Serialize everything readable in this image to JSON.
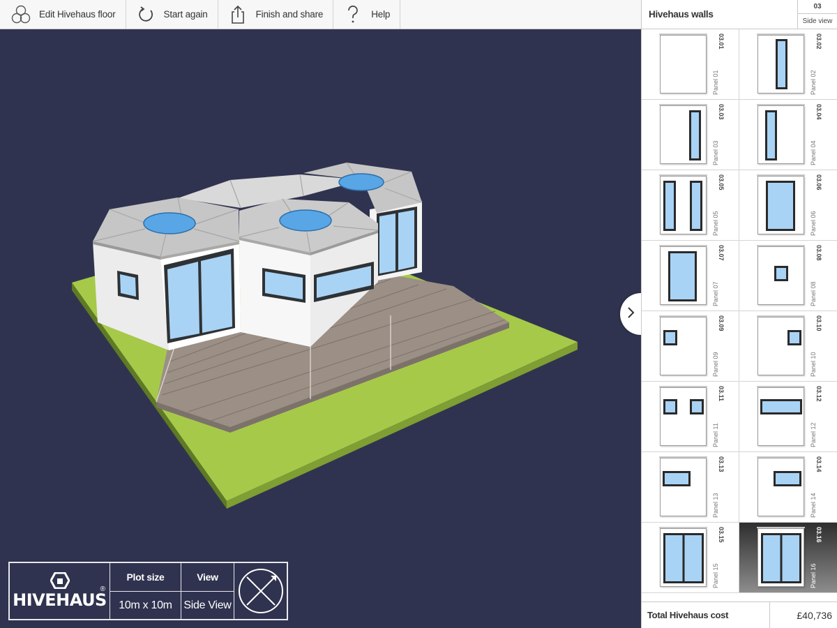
{
  "toolbar": {
    "edit_floor": "Edit Hivehaus floor",
    "start_again": "Start again",
    "finish_share": "Finish and share",
    "help": "Help"
  },
  "panel": {
    "title": "Hivehaus walls",
    "floor": "03",
    "view_label": "Side view",
    "tiles": [
      {
        "code": "03.01",
        "name": "Panel 01",
        "layout": "blank"
      },
      {
        "code": "03.02",
        "name": "Panel 02",
        "layout": "tall-center"
      },
      {
        "code": "03.03",
        "name": "Panel 03",
        "layout": "tall-right"
      },
      {
        "code": "03.04",
        "name": "Panel 04",
        "layout": "tall-left"
      },
      {
        "code": "03.05",
        "name": "Panel 05",
        "layout": "tall-pair"
      },
      {
        "code": "03.06",
        "name": "Panel 06",
        "layout": "wide-tall"
      },
      {
        "code": "03.07",
        "name": "Panel 07",
        "layout": "door-center"
      },
      {
        "code": "03.08",
        "name": "Panel 08",
        "layout": "small-center"
      },
      {
        "code": "03.09",
        "name": "Panel 09",
        "layout": "small-left"
      },
      {
        "code": "03.10",
        "name": "Panel 10",
        "layout": "small-right"
      },
      {
        "code": "03.11",
        "name": "Panel 11",
        "layout": "small-pair"
      },
      {
        "code": "03.12",
        "name": "Panel 12",
        "layout": "strip-wide"
      },
      {
        "code": "03.13",
        "name": "Panel 13",
        "layout": "strip-left"
      },
      {
        "code": "03.14",
        "name": "Panel 14",
        "layout": "strip-right"
      },
      {
        "code": "03.15",
        "name": "Panel 15",
        "layout": "double-door"
      },
      {
        "code": "03.16",
        "name": "Panel 16",
        "layout": "double-door",
        "selected": true
      }
    ],
    "cost_label": "Total Hivehaus cost",
    "cost_value": "£40,736"
  },
  "info": {
    "brand": "HIVEHAUS",
    "reg_mark": "®",
    "plot_size_label": "Plot size",
    "plot_size_value": "10m x 10m",
    "view_label": "View",
    "view_value": "Side View"
  },
  "colors": {
    "background": "#30334f",
    "grass": "#a6c94a",
    "deck": "#9b8f86",
    "roof": "#c4c4c4",
    "skylight": "#58a6e6",
    "glass": "#a9d3f5"
  }
}
